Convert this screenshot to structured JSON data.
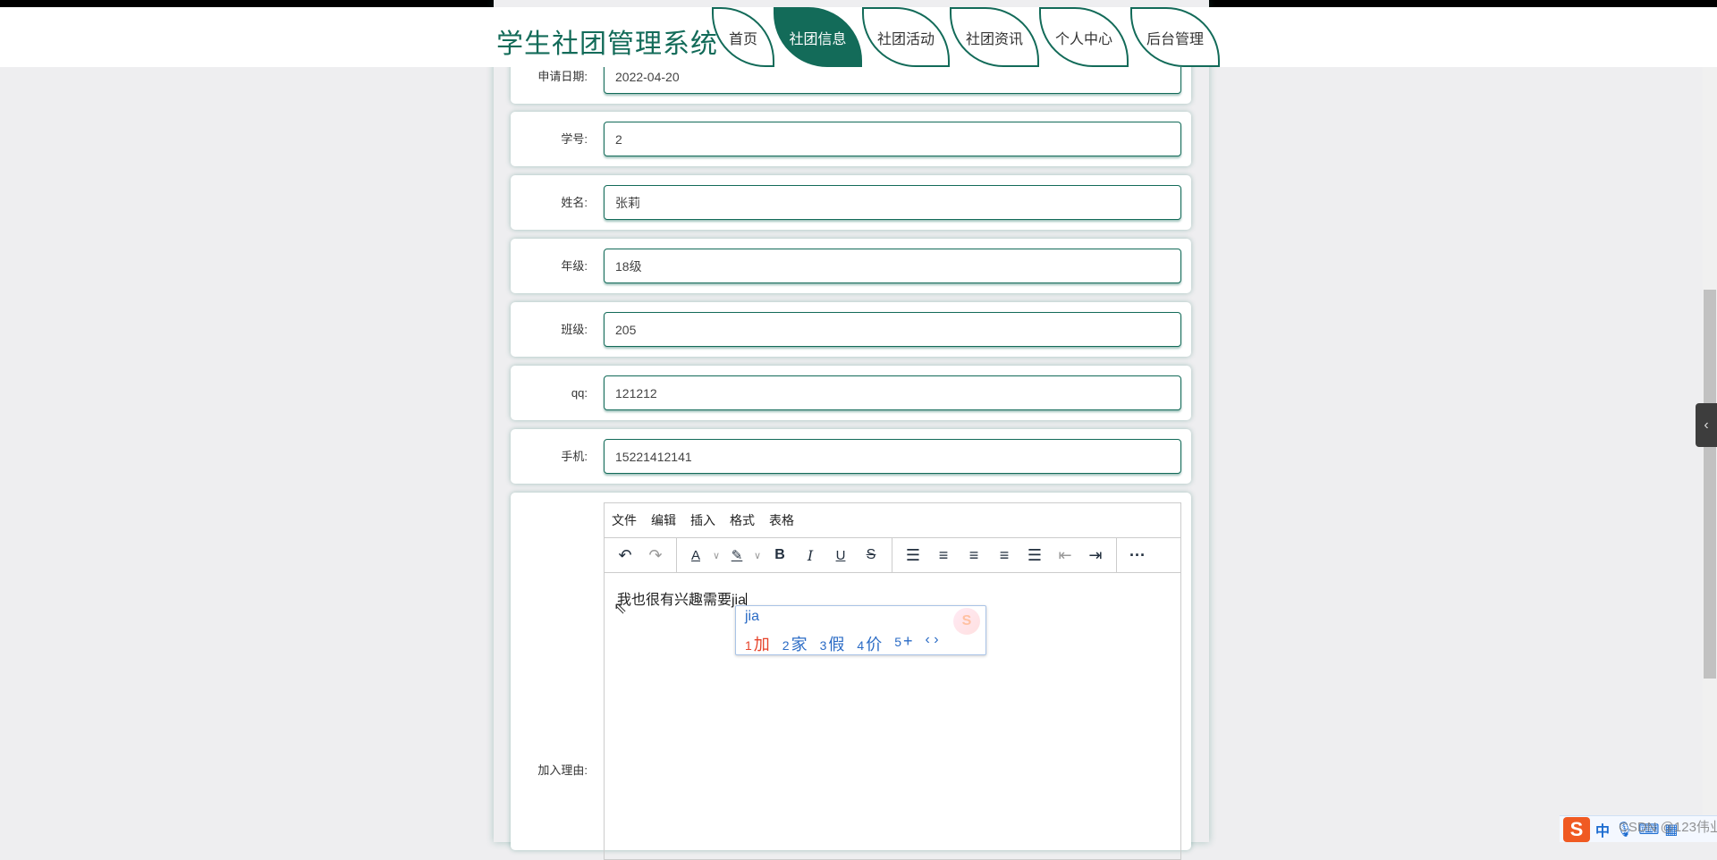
{
  "header": {
    "title": "学生社团管理系统",
    "tabs": [
      {
        "label": "首页"
      },
      {
        "label": "社团信息"
      },
      {
        "label": "社团活动"
      },
      {
        "label": "社团资讯"
      },
      {
        "label": "个人中心"
      },
      {
        "label": "后台管理"
      }
    ],
    "active_tab": "社团信息"
  },
  "form": {
    "fields": [
      {
        "label": "申请日期:",
        "value": "2022-04-20"
      },
      {
        "label": "学号:",
        "value": "2"
      },
      {
        "label": "姓名:",
        "value": "张莉"
      },
      {
        "label": "年级:",
        "value": "18级"
      },
      {
        "label": "班级:",
        "value": "205"
      },
      {
        "label": "qq:",
        "value": "121212"
      },
      {
        "label": "手机:",
        "value": "15221412141"
      }
    ],
    "reason_label": "加入理由:",
    "editor": {
      "menu": [
        "文件",
        "编辑",
        "插入",
        "格式",
        "表格"
      ],
      "content": "我也很有兴趣需要jia"
    }
  },
  "ime": {
    "input": "jia",
    "candidates": [
      {
        "n": "1",
        "c": "加"
      },
      {
        "n": "2",
        "c": "家"
      },
      {
        "n": "3",
        "c": "假"
      },
      {
        "n": "4",
        "c": "价"
      },
      {
        "n": "5",
        "c": "+"
      }
    ],
    "bar_mode": "中"
  },
  "watermark": "CSDN @123伟业",
  "colors": {
    "brand": "#136b59",
    "background": "#eeeef0"
  }
}
